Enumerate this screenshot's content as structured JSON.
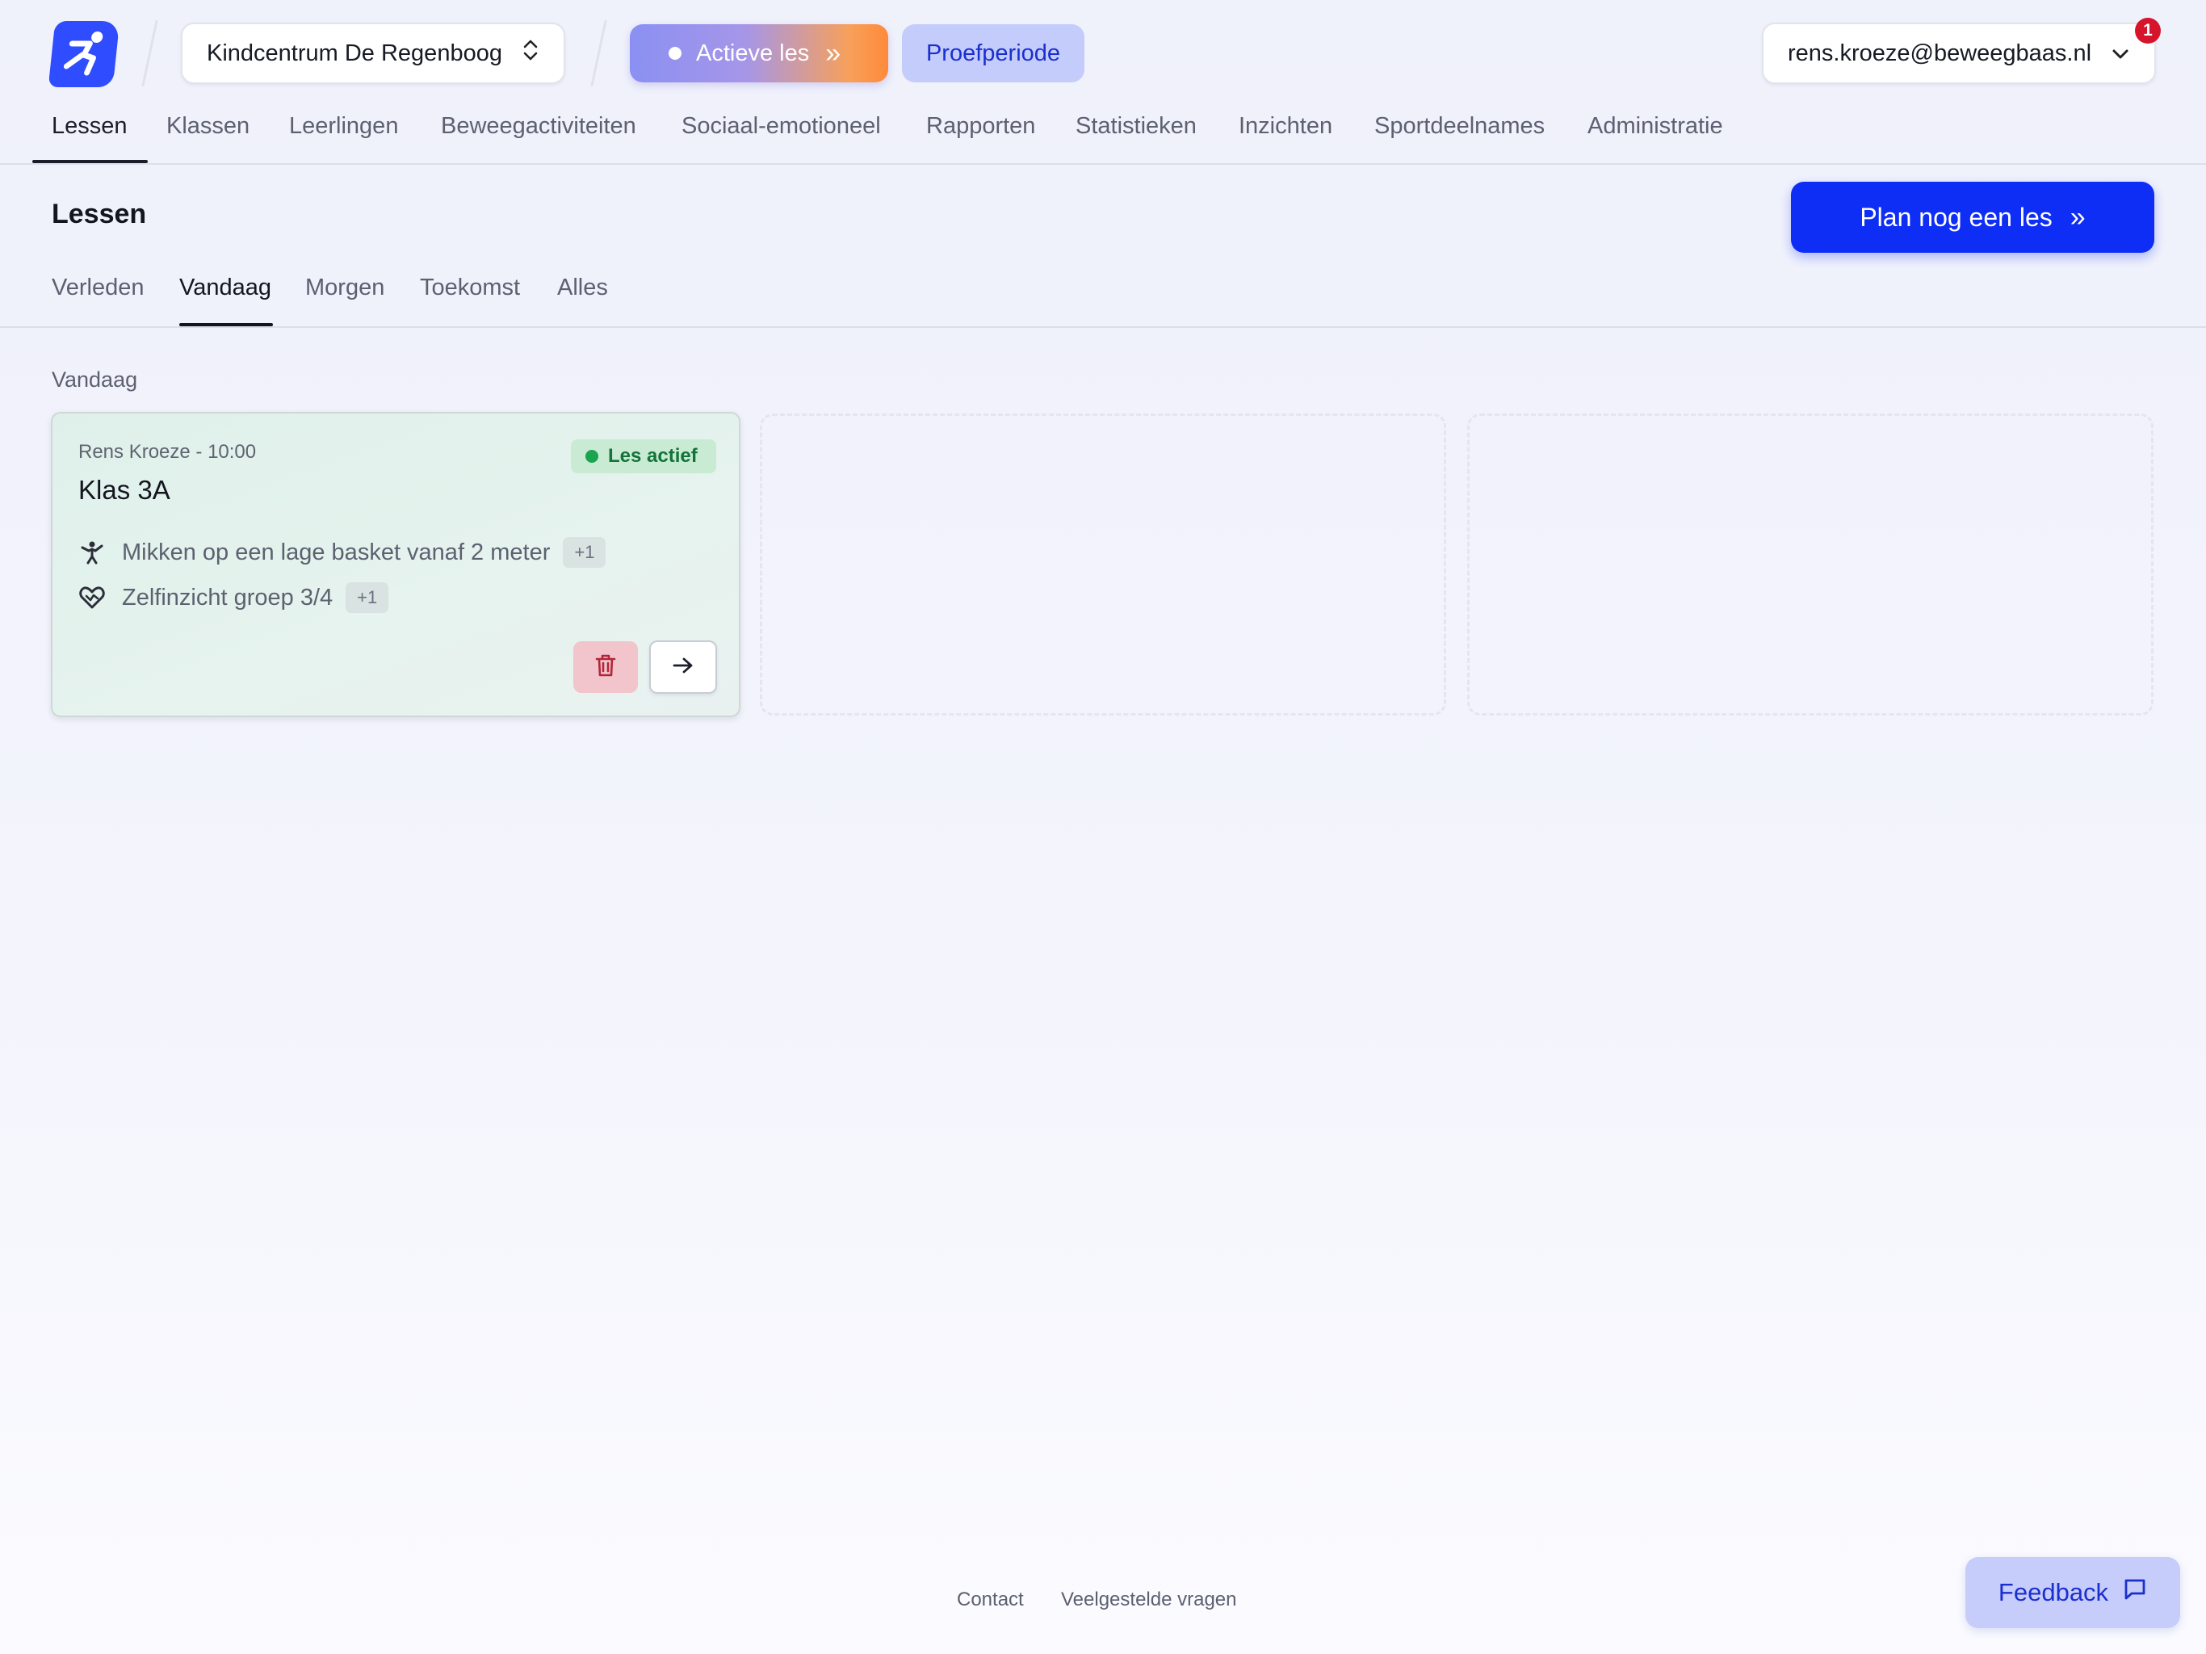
{
  "header": {
    "school": "Kindcentrum De Regenboog",
    "active_lesson_label": "Actieve les",
    "trial_label": "Proefperiode",
    "account_email": "rens.kroeze@beweegbaas.nl",
    "notification_count": "1"
  },
  "nav": {
    "items": [
      "Lessen",
      "Klassen",
      "Leerlingen",
      "Beweegactiviteiten",
      "Sociaal-emotioneel",
      "Rapporten",
      "Statistieken",
      "Inzichten",
      "Sportdeelnames",
      "Administratie"
    ],
    "active": "Lessen"
  },
  "page": {
    "title": "Lessen",
    "plan_button": "Plan nog een les"
  },
  "tabs": {
    "items": [
      "Verleden",
      "Vandaag",
      "Morgen",
      "Toekomst",
      "Alles"
    ],
    "active": "Vandaag"
  },
  "section": {
    "label": "Vandaag"
  },
  "lesson": {
    "teacher_time": "Rens Kroeze - 10:00",
    "class_name": "Klas 3A",
    "status": "Les actief",
    "activities": [
      {
        "icon": "sport-icon",
        "label": "Mikken op een lage basket vanaf 2 meter",
        "extra": "+1"
      },
      {
        "icon": "heart-hands-icon",
        "label": "Zelfinzicht groep 3/4",
        "extra": "+1"
      }
    ]
  },
  "footer": {
    "links": [
      "Contact",
      "Veelgestelde vragen"
    ],
    "feedback": "Feedback"
  },
  "colors": {
    "brand": "#2f4dff",
    "primary_button": "#0f2ef5",
    "active_status": "#13733a",
    "danger": "#b3263a"
  }
}
